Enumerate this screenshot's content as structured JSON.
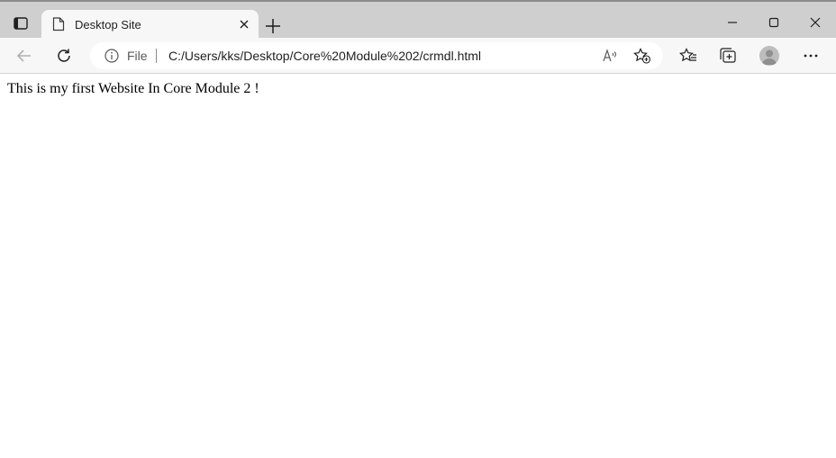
{
  "window": {
    "tab": {
      "title": "Desktop Site"
    },
    "icons": {
      "tab_actions": "tab-actions-icon",
      "favicon": "page-icon",
      "tab_close": "close-icon",
      "new_tab": "plus-icon",
      "minimize": "minimize-icon",
      "maximize": "maximize-icon",
      "close": "close-icon"
    }
  },
  "toolbar": {
    "address": {
      "scheme_label": "File",
      "url": "C:/Users/kks/Desktop/Core%20Module%202/crmdl.html"
    },
    "icons": {
      "back": "back-arrow-icon",
      "reload": "reload-icon",
      "info": "info-icon",
      "read_aloud": "read-aloud-icon",
      "add_favorite": "add-favorite-icon",
      "favorites": "favorites-icon",
      "collections": "collections-icon",
      "profile": "profile-avatar",
      "more": "more-icon"
    }
  },
  "page": {
    "text": "This is my first Website In Core Module 2 !"
  },
  "colors": {
    "tabstrip_bg": "#cfcfcf",
    "toolbar_bg": "#f7f7f7",
    "page_bg": "#ffffff"
  }
}
